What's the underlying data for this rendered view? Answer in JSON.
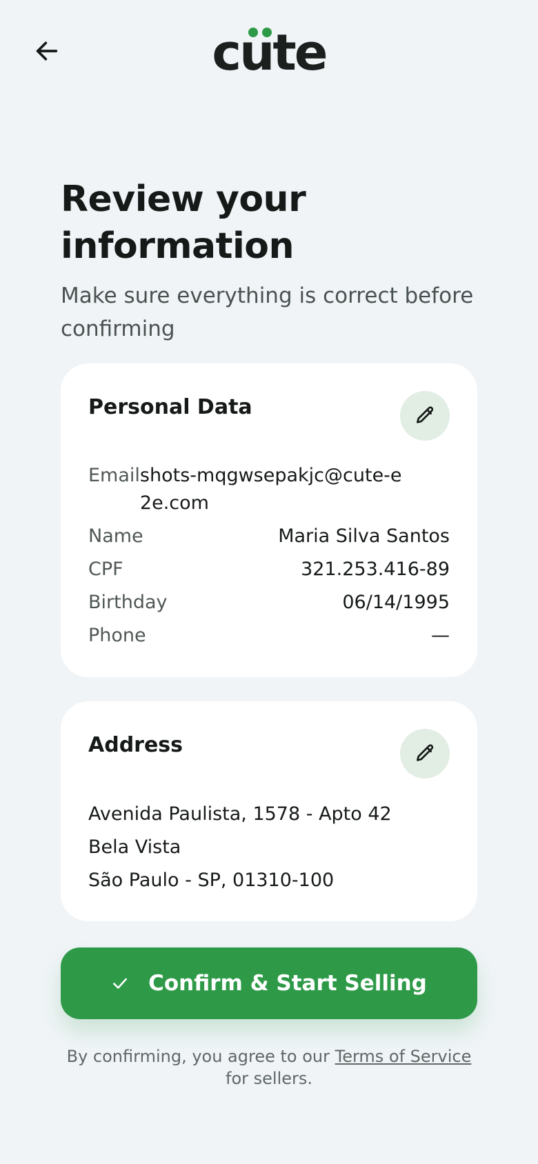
{
  "header": {
    "logo_text": "cute",
    "back_icon": "arrow-left-icon",
    "accent_color": "#2e9a48"
  },
  "page": {
    "title": "Review your information",
    "subtitle": "Make sure everything is correct before confirming"
  },
  "personal": {
    "title": "Personal Data",
    "edit_icon": "pencil-icon",
    "fields": {
      "email_label": "Email",
      "email_value": "shots-mqgwsepakjc@cute-e2e.com",
      "name_label": "Name",
      "name_value": "Maria Silva Santos",
      "cpf_label": "CPF",
      "cpf_value": "321.253.416-89",
      "birthday_label": "Birthday",
      "birthday_value": "06/14/1995",
      "phone_label": "Phone",
      "phone_value": "—"
    }
  },
  "address": {
    "title": "Address",
    "edit_icon": "pencil-icon",
    "line1": "Avenida Paulista, 1578 - Apto 42",
    "line2": "Bela Vista",
    "line3": "São Paulo - SP, 01310-100"
  },
  "confirm": {
    "label": "Confirm & Start Selling",
    "icon": "check-icon"
  },
  "legal": {
    "prefix": "By confirming, you agree to our ",
    "link": "Terms of Service",
    "suffix": " for sellers."
  }
}
